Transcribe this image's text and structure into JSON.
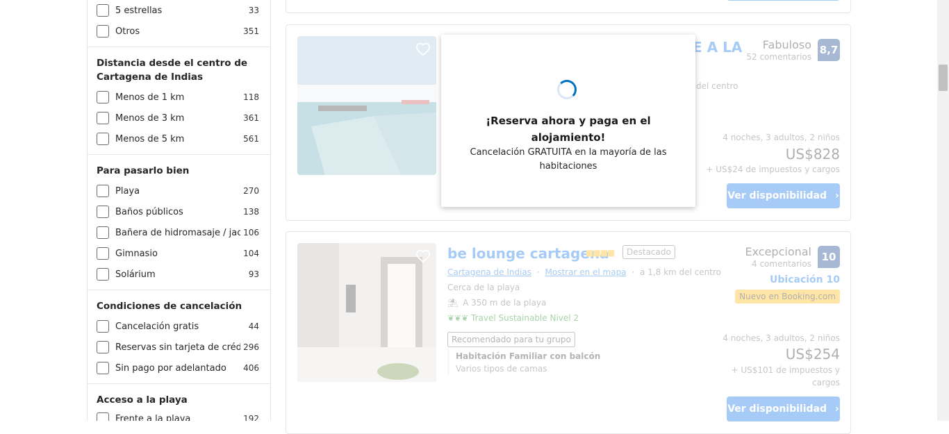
{
  "filters": {
    "stars_group": [
      {
        "label": "5 estrellas",
        "count": "33"
      },
      {
        "label": "Otros",
        "count": "351"
      }
    ],
    "distance": {
      "title": "Distancia desde el centro de Cartagena de Indias",
      "items": [
        {
          "label": "Menos de 1 km",
          "count": "118"
        },
        {
          "label": "Menos de 3 km",
          "count": "361"
        },
        {
          "label": "Menos de 5 km",
          "count": "561"
        }
      ]
    },
    "fun": {
      "title": "Para pasarlo bien",
      "items": [
        {
          "label": "Playa",
          "count": "270"
        },
        {
          "label": "Baños públicos",
          "count": "138"
        },
        {
          "label": "Bañera de hidromasaje / jacuzzi",
          "count": "106"
        },
        {
          "label": "Gimnasio",
          "count": "104"
        },
        {
          "label": "Solárium",
          "count": "93"
        }
      ]
    },
    "cancellation": {
      "title": "Condiciones de cancelación",
      "items": [
        {
          "label": "Cancelación gratis",
          "count": "44"
        },
        {
          "label": "Reservas sin tarjeta de crédito",
          "count": "296"
        },
        {
          "label": "Sin pago por adelantado",
          "count": "406"
        }
      ]
    },
    "beach": {
      "title": "Acceso a la playa",
      "items": [
        {
          "label": "Frente a la playa",
          "count": "192"
        }
      ]
    }
  },
  "cards": {
    "first": {
      "name_partial": "E A LA",
      "rating_word": "Fabuloso",
      "rating_count": "52 comentarios",
      "score": "8,7",
      "distance_partial": "del centro",
      "stay": "4 noches, 3 adultos, 2 niños",
      "price": "US$828",
      "taxes": "+ US$24 de impuestos y cargos",
      "button": "Ver disponibilidad"
    },
    "second": {
      "name": "be lounge cartagena",
      "badge": "Destacado",
      "city_link": "Cartagena de Indias",
      "map_link": "Mostrar en el mapa",
      "distance": "a 1,8 km del centro",
      "beach_near": "Cerca de la playa",
      "beach_dist": "A 350 m de la playa",
      "sustainable": "Travel Sustainable Nivel 2",
      "group_tag": "Recomendado para tu grupo",
      "room_name": "Habitación Familiar con balcón",
      "room_beds": "Varios tipos de camas",
      "rating_word": "Excepcional",
      "rating_count": "4 comentarios",
      "score": "10",
      "location_score": "Ubicación 10",
      "new_badge": "Nuevo en Booking.com",
      "stay": "4 noches, 3 adultos, 2 niños",
      "price": "US$254",
      "taxes_line1": "+ US$101 de impuestos y",
      "taxes_line2": "cargos",
      "button": "Ver disponibilidad"
    }
  },
  "popup": {
    "title": "¡Reserva ahora y paga en el alojamiento!",
    "subtitle": "Cancelación GRATUITA en la mayoría de las habitaciones"
  },
  "colors": {
    "accent": "#006ce4",
    "score_bg": "#003580",
    "new_badge_bg": "#ffb700"
  }
}
